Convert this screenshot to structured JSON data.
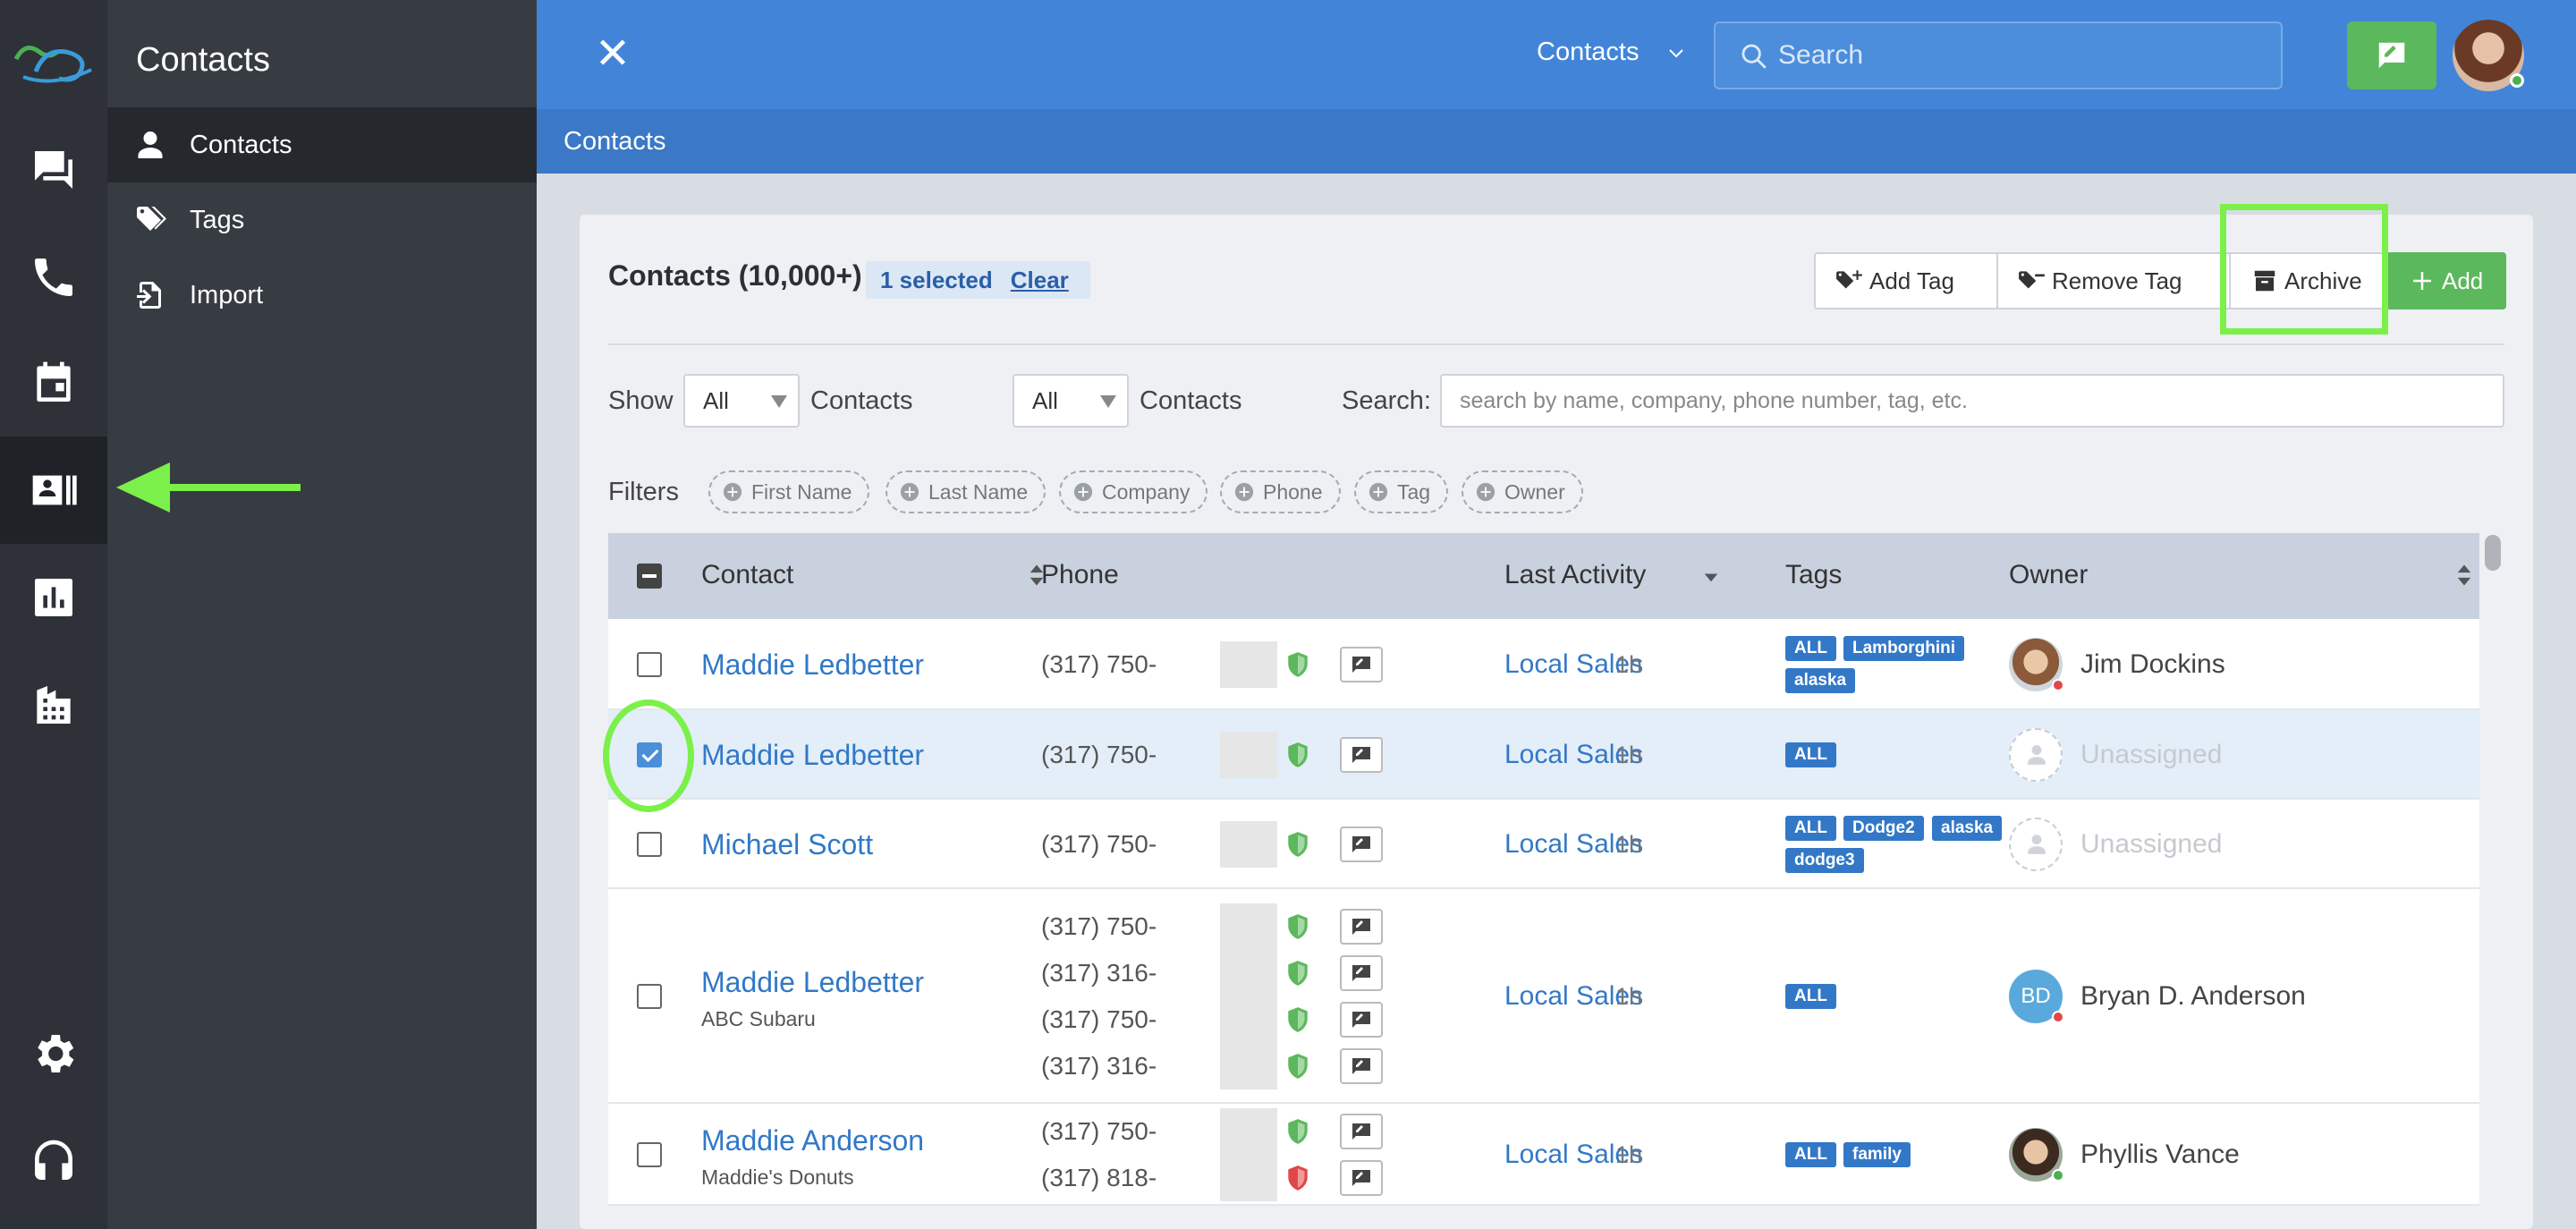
{
  "rail": {
    "items": [
      {
        "name": "messages-icon"
      },
      {
        "name": "phone-icon"
      },
      {
        "name": "calendar-icon"
      },
      {
        "name": "contacts-icon",
        "active": true
      },
      {
        "name": "reports-icon"
      },
      {
        "name": "organization-icon"
      },
      {
        "name": "settings-icon"
      },
      {
        "name": "support-headset-icon"
      }
    ]
  },
  "sidepanel": {
    "title": "Contacts",
    "items": [
      {
        "label": "Contacts",
        "icon": "person-icon",
        "active": true
      },
      {
        "label": "Tags",
        "icon": "tags-icon"
      },
      {
        "label": "Import",
        "icon": "import-icon"
      }
    ]
  },
  "header": {
    "contacts_menu": "Contacts",
    "search_placeholder": "Search"
  },
  "subheader": {
    "title": "Contacts"
  },
  "card": {
    "title": "Contacts (10,000+)",
    "selected_text": "1 selected",
    "clear_label": "Clear",
    "toolbar": {
      "add_tag": "Add Tag",
      "remove_tag": "Remove Tag",
      "archive": "Archive",
      "add": "Add"
    },
    "show_label": "Show",
    "select1_value": "All",
    "contacts_label1": "Contacts",
    "select2_value": "All",
    "contacts_label2": "Contacts",
    "search_label": "Search:",
    "search_placeholder": "search by name, company, phone number, tag, etc.",
    "filters_label": "Filters",
    "filters": [
      "First Name",
      "Last Name",
      "Company",
      "Phone",
      "Tag",
      "Owner"
    ]
  },
  "table": {
    "columns": [
      "Contact",
      "Phone",
      "Last Activity",
      "Tags",
      "Owner"
    ],
    "rows": [
      {
        "name": "Maddie Ledbetter",
        "company": "",
        "phones": [
          "(317) 750-"
        ],
        "shields": [
          "green"
        ],
        "activity": "Local Sales",
        "time": "1h",
        "tags": [
          "ALL",
          "Lamborghini",
          "alaska"
        ],
        "owner": "Jim Dockins",
        "owner_status": "red",
        "selected": false
      },
      {
        "name": "Maddie Ledbetter",
        "company": "",
        "phones": [
          "(317) 750-"
        ],
        "shields": [
          "green"
        ],
        "activity": "Local Sales",
        "time": "1h",
        "tags": [
          "ALL"
        ],
        "owner": "Unassigned",
        "selected": true
      },
      {
        "name": "Michael Scott",
        "company": "",
        "phones": [
          "(317) 750-"
        ],
        "shields": [
          "green"
        ],
        "activity": "Local Sales",
        "time": "1h",
        "tags": [
          "ALL",
          "Dodge2",
          "alaska",
          "dodge3"
        ],
        "owner": "Unassigned",
        "selected": false
      },
      {
        "name": "Maddie Ledbetter",
        "company": "ABC Subaru",
        "phones": [
          "(317) 750-",
          "(317) 316-",
          "(317) 750-",
          "(317) 316-"
        ],
        "shields": [
          "green",
          "green",
          "green",
          "green"
        ],
        "activity": "Local Sales",
        "time": "1h",
        "tags": [
          "ALL"
        ],
        "owner": "Bryan D. Anderson",
        "owner_initials": "BD",
        "owner_status": "red",
        "selected": false
      },
      {
        "name": "Maddie Anderson",
        "company": "Maddie's Donuts",
        "phones": [
          "(317) 750-",
          "(317) 818-"
        ],
        "shields": [
          "green",
          "red"
        ],
        "activity": "Local Sales",
        "time": "1h",
        "tags": [
          "ALL",
          "family"
        ],
        "owner": "Phyllis Vance",
        "owner_status": "green",
        "selected": false
      }
    ]
  },
  "colors": {
    "header_blue": "#4285d8",
    "link_blue": "#3278c7",
    "success_green": "#5cb85c",
    "highlight_green": "#7cf04a",
    "shield_green": "#5cb85c",
    "shield_red": "#e04848"
  }
}
